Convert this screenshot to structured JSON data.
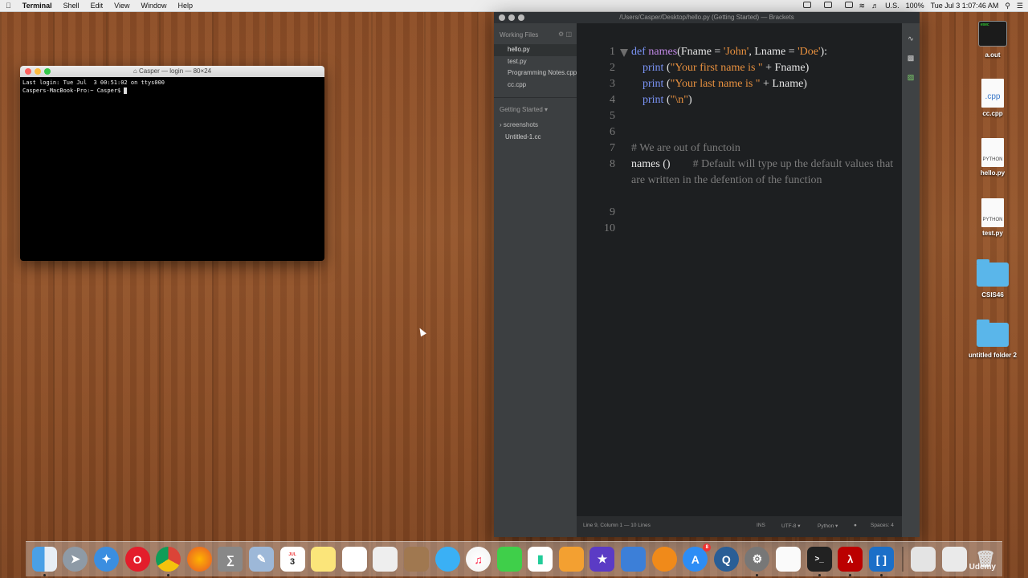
{
  "menubar": {
    "app": "Terminal",
    "items": [
      "Shell",
      "Edit",
      "View",
      "Window",
      "Help"
    ],
    "input_source": "U.S.",
    "battery": "100%",
    "clock": "Tue Jul 3  1:07:46 AM"
  },
  "terminal": {
    "title": "Casper — login — 80×24",
    "line1": "Last login: Tue Jul  3 00:51:02 on ttys000",
    "line2": "Caspers-MacBook-Pro:~ Casper$ "
  },
  "brackets": {
    "title": "/Users/Casper/Desktop/hello.py (Getting Started) — Brackets",
    "working_files_label": "Working Files",
    "working_files": [
      "hello.py",
      "test.py",
      "Programming Notes.cpp",
      "cc.cpp"
    ],
    "project_label": "Getting Started",
    "folder": "screenshots",
    "project_file": "Untitled-1.cc",
    "line_numbers": [
      "1",
      "2",
      "3",
      "4",
      "5",
      "6",
      "7",
      "8",
      "9",
      "10"
    ],
    "code": {
      "l1_kw": "def",
      "l1_fn": "names",
      "l1_a": "(Fname = ",
      "l1_s1": "'John'",
      "l1_b": ", Lname = ",
      "l1_s2": "'Doe'",
      "l1_c": "):",
      "l2_kw": "print",
      "l2_a": " (",
      "l2_s": "\"Your first name is \"",
      "l2_b": " + Fname)",
      "l3_kw": "print",
      "l3_a": " (",
      "l3_s": "\"Your last name is \"",
      "l3_b": " + Lname)",
      "l4_kw": "print",
      "l4_a": " (",
      "l4_s": "\"\\n\"",
      "l4_b": ")",
      "l7_cm": "# We are out of functoin",
      "l8_call": "names ()",
      "l8_cm": "# Default will type up the default values that are written in the defention of the function"
    },
    "status": {
      "cursor": "Line 9, Column 1 — 10 Lines",
      "mode": "INS",
      "encoding": "UTF-8",
      "language": "Python",
      "spaces": "Spaces: 4"
    }
  },
  "desktop_icons": [
    {
      "label": "a.out",
      "kind": "exec",
      "badge": "exec"
    },
    {
      "label": "cc.cpp",
      "kind": "doc",
      "badge": ".cpp"
    },
    {
      "label": "hello.py",
      "kind": "doc",
      "badge": "PYTHON"
    },
    {
      "label": "test.py",
      "kind": "doc",
      "badge": "PYTHON"
    },
    {
      "label": "CSIS46",
      "kind": "folder"
    },
    {
      "label": "untitled folder 2",
      "kind": "folder"
    }
  ],
  "dock": {
    "calendar_month": "JUL",
    "calendar_day": "3",
    "appstore_badge": "8"
  },
  "watermark": "Udemy"
}
